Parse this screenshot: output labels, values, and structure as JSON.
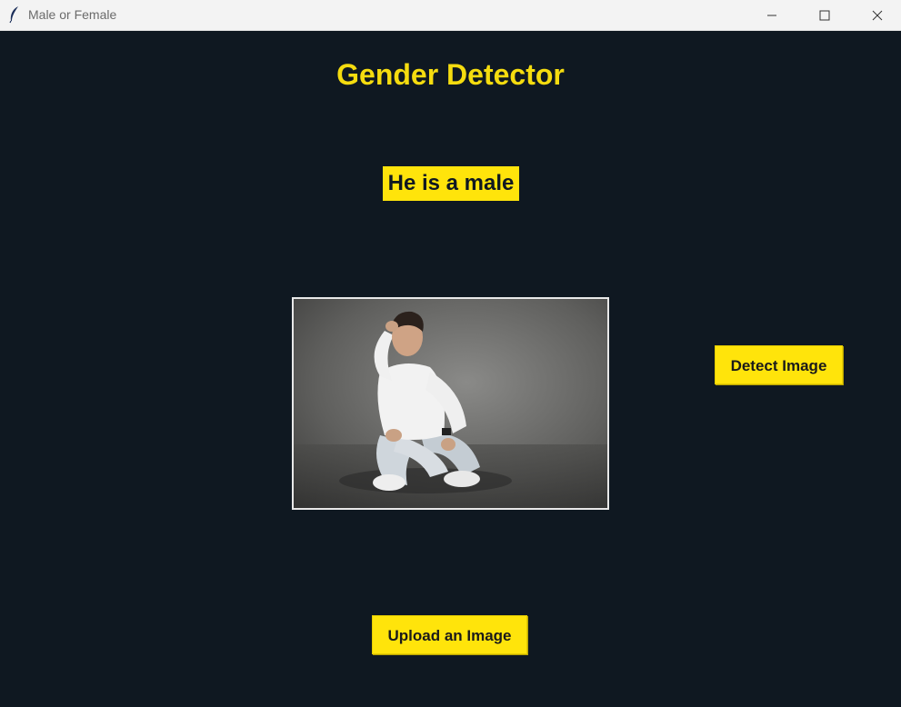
{
  "window": {
    "title": "Male or Female",
    "icon": "feather-icon",
    "controls": [
      "minimize-icon",
      "maximize-icon",
      "close-icon"
    ]
  },
  "main": {
    "heading": "Gender Detector",
    "result": "He is a male",
    "image_description_icon": "photo-of-seated-man",
    "detect_button": "Detect Image",
    "upload_button": "Upload an Image"
  },
  "colors": {
    "background": "#0f1821",
    "accent": "#ffe40b",
    "heading": "#f5dc0f"
  }
}
